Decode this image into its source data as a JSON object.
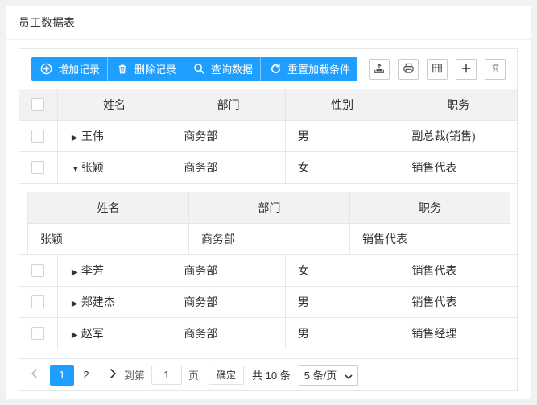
{
  "panel": {
    "title": "员工数据表"
  },
  "toolbar": {
    "buttons": [
      {
        "label": "增加记录",
        "icon": "plus-circle-icon"
      },
      {
        "label": "删除记录",
        "icon": "trash-icon"
      },
      {
        "label": "查询数据",
        "icon": "search-icon"
      },
      {
        "label": "重置加载条件",
        "icon": "refresh-icon"
      }
    ],
    "tools": [
      "export-icon",
      "print-icon",
      "columns-icon",
      "plus-icon",
      "delete-icon"
    ],
    "accent_color": "#1e9fff"
  },
  "table": {
    "headers": [
      "姓名",
      "部门",
      "性别",
      "职务"
    ],
    "rows": [
      {
        "name": "王伟",
        "dept": "商务部",
        "gender": "男",
        "title": "副总裁(销售)",
        "expanded": false
      },
      {
        "name": "张颖",
        "dept": "商务部",
        "gender": "女",
        "title": "销售代表",
        "expanded": true
      },
      {
        "name": "李芳",
        "dept": "商务部",
        "gender": "女",
        "title": "销售代表",
        "expanded": false
      },
      {
        "name": "郑建杰",
        "dept": "商务部",
        "gender": "男",
        "title": "销售代表",
        "expanded": false
      },
      {
        "name": "赵军",
        "dept": "商务部",
        "gender": "男",
        "title": "销售经理",
        "expanded": false
      }
    ],
    "subtable": {
      "headers": [
        "姓名",
        "部门",
        "职务"
      ],
      "row": [
        "张颖",
        "商务部",
        "销售代表"
      ]
    }
  },
  "pager": {
    "pages": [
      "1",
      "2"
    ],
    "current": "1",
    "goto_label": "到第",
    "goto_value": "1",
    "page_unit": "页",
    "confirm_label": "确定",
    "total_text": "共 10 条",
    "page_size": "5 条/页"
  }
}
